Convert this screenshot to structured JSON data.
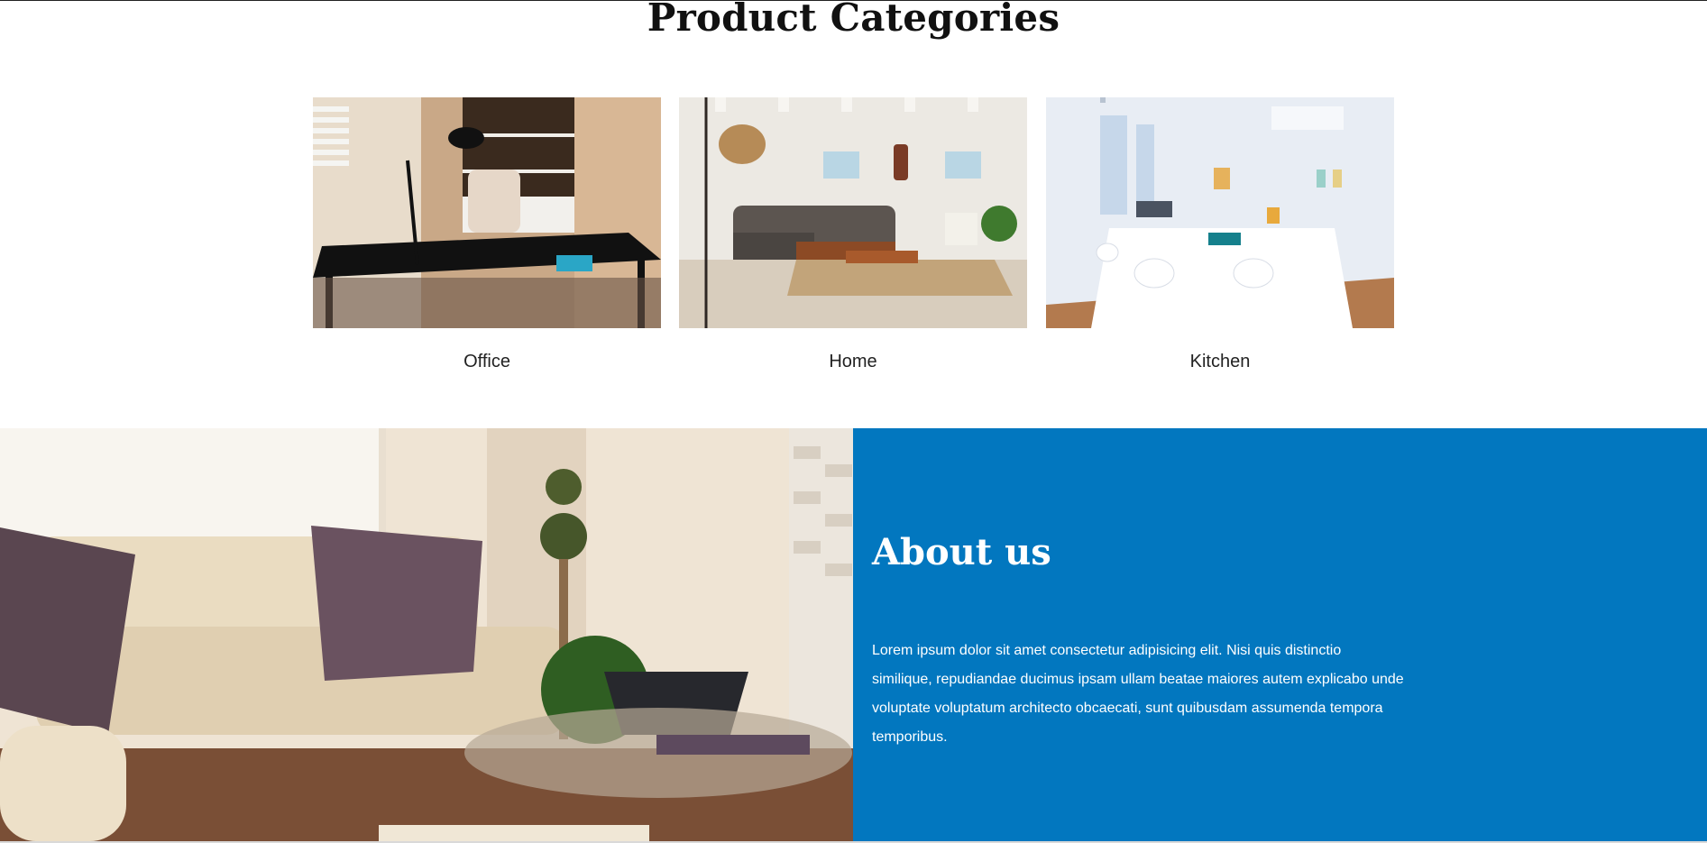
{
  "categories_section": {
    "title": "Product Categories",
    "items": [
      {
        "label": "Office"
      },
      {
        "label": "Home"
      },
      {
        "label": "Kitchen"
      }
    ]
  },
  "about": {
    "title": "About us",
    "text": "Lorem ipsum dolor sit amet consectetur adipisicing elit. Nisi quis distinctio similique, repudiandae ducimus ipsam ullam beatae maiores autem explicabo unde voluptate voluptatum architecto obcaecati, sunt quibusdam assumenda tempora temporibus."
  },
  "colors": {
    "about_background": "#0277bf",
    "title_text": "#111111",
    "about_text": "#ffffff"
  }
}
